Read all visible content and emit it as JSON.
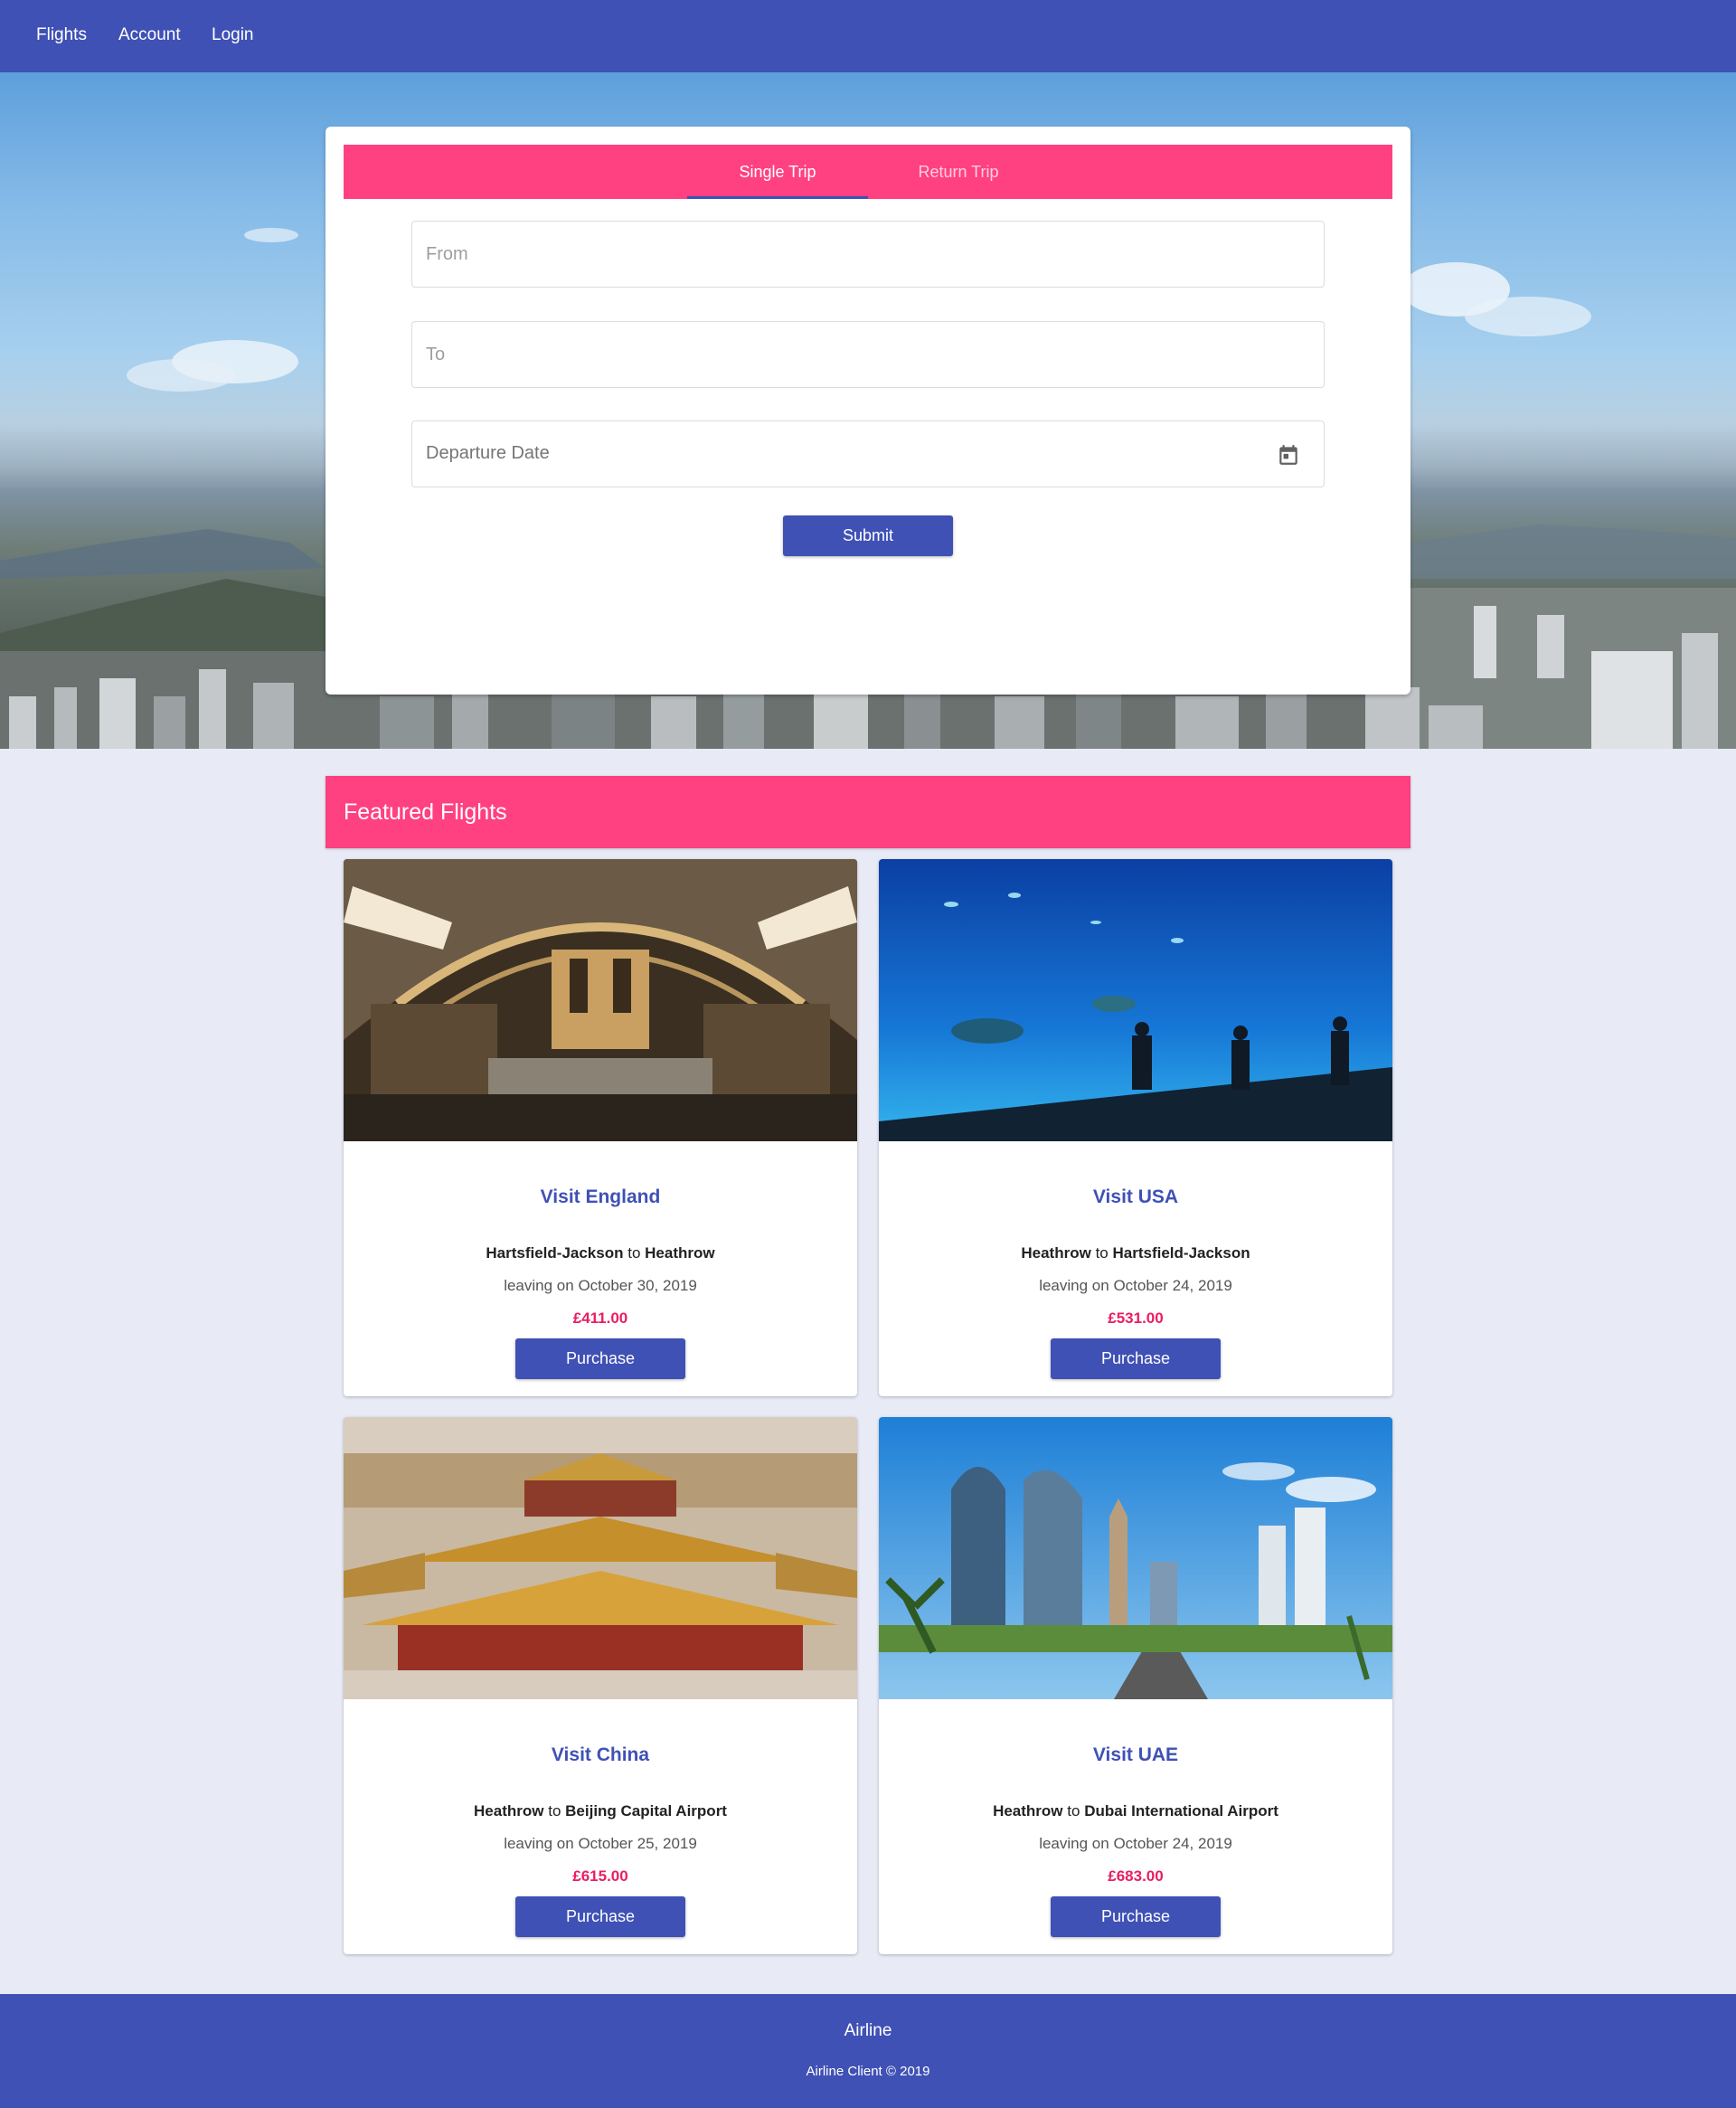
{
  "nav": {
    "items": [
      {
        "label": "Flights"
      },
      {
        "label": "Account"
      },
      {
        "label": "Login"
      }
    ]
  },
  "search": {
    "tabs": [
      {
        "label": "Single Trip",
        "active": true
      },
      {
        "label": "Return Trip",
        "active": false
      }
    ],
    "from_placeholder": "From",
    "to_placeholder": "To",
    "date_label": "Departure Date",
    "submit_label": "Submit"
  },
  "featured": {
    "title": "Featured Flights",
    "cards": [
      {
        "title": "Visit England",
        "origin": "Hartsfield-Jackson",
        "connector": "to",
        "destination": "Heathrow",
        "leaving_prefix": "leaving on",
        "date": "October 30, 2019",
        "price": "£411.00",
        "button": "Purchase",
        "image": "museum-hall"
      },
      {
        "title": "Visit USA",
        "origin": "Heathrow",
        "connector": "to",
        "destination": "Hartsfield-Jackson",
        "leaving_prefix": "leaving on",
        "date": "October 24, 2019",
        "price": "£531.00",
        "button": "Purchase",
        "image": "aquarium"
      },
      {
        "title": "Visit China",
        "origin": "Heathrow",
        "connector": "to",
        "destination": "Beijing Capital Airport",
        "leaving_prefix": "leaving on",
        "date": "October 25, 2019",
        "price": "£615.00",
        "button": "Purchase",
        "image": "forbidden-city"
      },
      {
        "title": "Visit UAE",
        "origin": "Heathrow",
        "connector": "to",
        "destination": "Dubai International Airport",
        "leaving_prefix": "leaving on",
        "date": "October 24, 2019",
        "price": "£683.00",
        "button": "Purchase",
        "image": "dubai-skyline"
      }
    ]
  },
  "footer": {
    "brand": "Airline",
    "copyright": "Airline Client © 2019"
  },
  "colors": {
    "primary": "#3f51b5",
    "accent": "#ff4081",
    "price": "#e91e63",
    "page_bg": "#e8eaf6"
  }
}
